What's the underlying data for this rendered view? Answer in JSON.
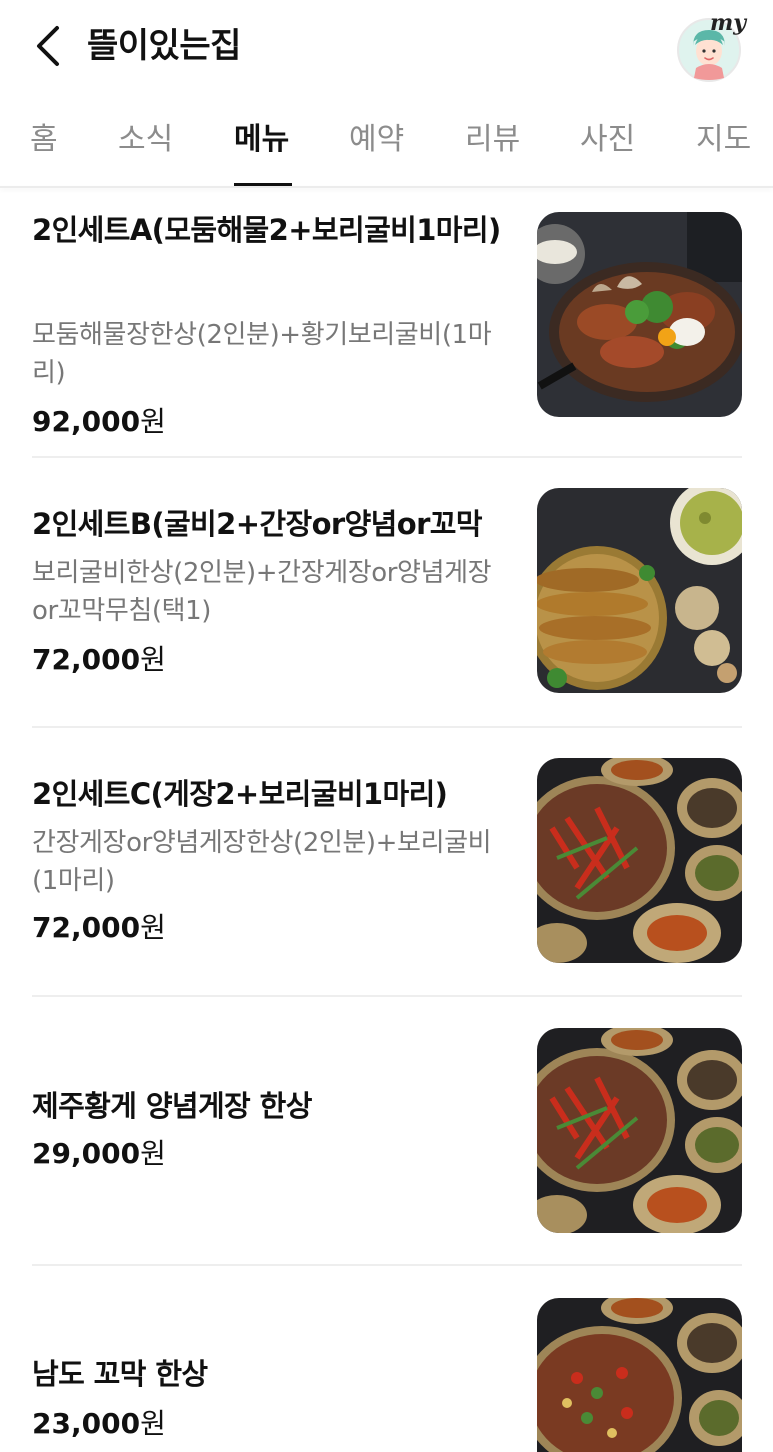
{
  "header": {
    "title": "뜰이있는집",
    "my_label": "my"
  },
  "tabs": [
    {
      "label": "홈"
    },
    {
      "label": "소식"
    },
    {
      "label": "메뉴"
    },
    {
      "label": "예약"
    },
    {
      "label": "리뷰"
    },
    {
      "label": "사진"
    },
    {
      "label": "지도"
    }
  ],
  "active_tab": "메뉴",
  "menu": [
    {
      "name": "2인세트A(모둠해물2+보리굴비1마리)",
      "description": "모둠해물장한상(2인분)+황기보리굴비(1마리)",
      "price": "92,000",
      "currency": "원"
    },
    {
      "name": "2인세트B(굴비2+간장or양념or꼬막",
      "description": "보리굴비한상(2인분)+간장게장or양념게장or꼬막무침(택1)",
      "price": "72,000",
      "currency": "원"
    },
    {
      "name": "2인세트C(게장2+보리굴비1마리)",
      "description": "간장게장or양념게장한상(2인분)+보리굴비(1마리)",
      "price": "72,000",
      "currency": "원"
    },
    {
      "name": "제주황게 양념게장 한상",
      "description": "",
      "price": "29,000",
      "currency": "원"
    },
    {
      "name": "남도 꼬막 한상",
      "description": "",
      "price": "23,000",
      "currency": "원"
    }
  ],
  "colors": {
    "text_primary": "#111111",
    "text_secondary": "#777777",
    "tab_inactive": "#8c8c8c",
    "divider": "#eeeeee"
  }
}
